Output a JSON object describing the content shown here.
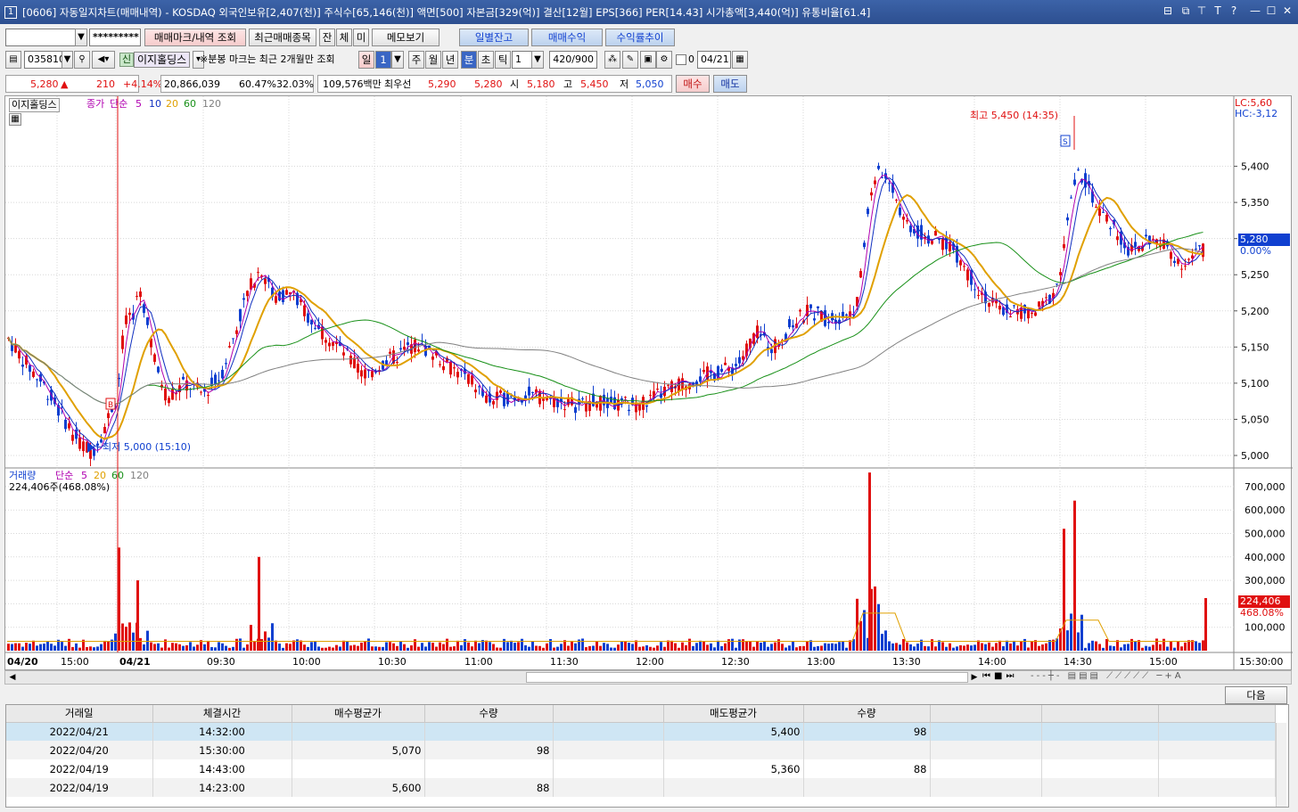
{
  "title": "[0606] 자동일지차트(매매내역) - KOSDAQ 외국인보유[2,407(천)] 주식수[65,146(천)] 액면[500] 자본금[329(억)] 결산[12월] EPS[366] PER[14.43] 시가총액[3,440(억)] 유통비율[61.4]",
  "window_num": "1",
  "toolbar1": {
    "password": "*********",
    "btn_mark": "매매마크/내역 조회",
    "btn_recent": "최근매매종목",
    "btn_jan": "잔",
    "btn_che": "체",
    "btn_mi": "미",
    "btn_memo": "메모보기",
    "btn_daily": "일별잔고",
    "btn_profit": "매매수익",
    "btn_rate": "수익률추이"
  },
  "toolbar2": {
    "code": "035810",
    "stock_badge": "신",
    "stock_name": "이지홀딩스",
    "note": "※분봉 마크는 최근 2개월만 조회",
    "period_day": "일",
    "period_num": "1",
    "week": "주",
    "month": "월",
    "year": "년",
    "minute": "분",
    "second": "초",
    "tick": "틱",
    "interval": "1",
    "count": "420/900",
    "zero": "0",
    "date": "04/21"
  },
  "quote": {
    "price": "5,280",
    "arrow": "▲",
    "change": "210",
    "pct": "+4.14%",
    "volume": "20,866,039",
    "ratio1": "60.47%",
    "ratio2": "32.03%",
    "amount": "109,576백만",
    "best_label": "최우선",
    "ask": "5,290",
    "bid": "5,280",
    "open_label": "시",
    "open": "5,180",
    "high_label": "고",
    "high": "5,450",
    "low_label": "저",
    "low": "5,050",
    "buy": "매수",
    "sell": "매도"
  },
  "price_panel": {
    "legend_name": "이지홀딩스",
    "legend_close": "종가",
    "legend_ma": "단순",
    "ma1": "5",
    "ma2": "10",
    "ma3": "20",
    "ma4": "60",
    "ma5": "120",
    "lc": "LC:5,60",
    "hc": "HC:-3,12",
    "max_label": "최고 5,450 (14:35)",
    "min_label": "최저 5,000 (15:10)",
    "current": "5,280",
    "current_pct": "0.00%",
    "buy_mark": "B",
    "sell_mark": "S"
  },
  "volume_panel": {
    "legend_name": "거래량",
    "legend_ma": "단순",
    "ma1": "5",
    "ma2": "20",
    "ma3": "60",
    "ma4": "120",
    "current_text": "224,406주(468.08%)",
    "current": "224,406",
    "current_pct": "468.08%"
  },
  "colors": {
    "up": "#e01010",
    "down": "#1040d0",
    "ma5": "#b000b0",
    "ma10": "#1030c0",
    "ma20": "#e0a000",
    "ma60": "#189018",
    "ma120": "#808080"
  },
  "chart_data": {
    "type": "candlestick",
    "y_axis": [
      5000,
      5050,
      5100,
      5150,
      5200,
      5250,
      5300,
      5350,
      5400
    ],
    "y_labels": [
      "5,000",
      "5,050",
      "5,100",
      "5,150",
      "5,200",
      "5,250",
      "5,300",
      "5,350",
      "5,400"
    ],
    "vol_axis": [
      100000,
      200000,
      300000,
      400000,
      500000,
      600000,
      700000
    ],
    "vol_labels": [
      "100,000",
      "200,000",
      "300,000",
      "400,000",
      "500,000",
      "600,000",
      "700,000"
    ],
    "x_labels": [
      "04/20",
      "15:00",
      "04/21",
      "09:30",
      "10:00",
      "10:30",
      "11:00",
      "11:30",
      "12:00",
      "12:30",
      "13:00",
      "13:30",
      "14:00",
      "14:30",
      "15:00",
      "15:30:00"
    ],
    "high": 5450,
    "low": 5000,
    "last": 5280
  },
  "table": {
    "headers": [
      "거래일",
      "체결시간",
      "매수평균가",
      "수량",
      "",
      "매도평균가",
      "수량",
      "",
      "",
      ""
    ],
    "rows": [
      [
        "2022/04/21",
        "14:32:00",
        "",
        "",
        "",
        "5,400",
        "98",
        "",
        "",
        ""
      ],
      [
        "2022/04/20",
        "15:30:00",
        "5,070",
        "98",
        "",
        "",
        "",
        "",
        "",
        ""
      ],
      [
        "2022/04/19",
        "14:43:00",
        "",
        "",
        "",
        "5,360",
        "88",
        "",
        "",
        ""
      ],
      [
        "2022/04/19",
        "14:23:00",
        "5,600",
        "88",
        "",
        "",
        "",
        "",
        "",
        ""
      ]
    ]
  },
  "next_btn": "다음"
}
